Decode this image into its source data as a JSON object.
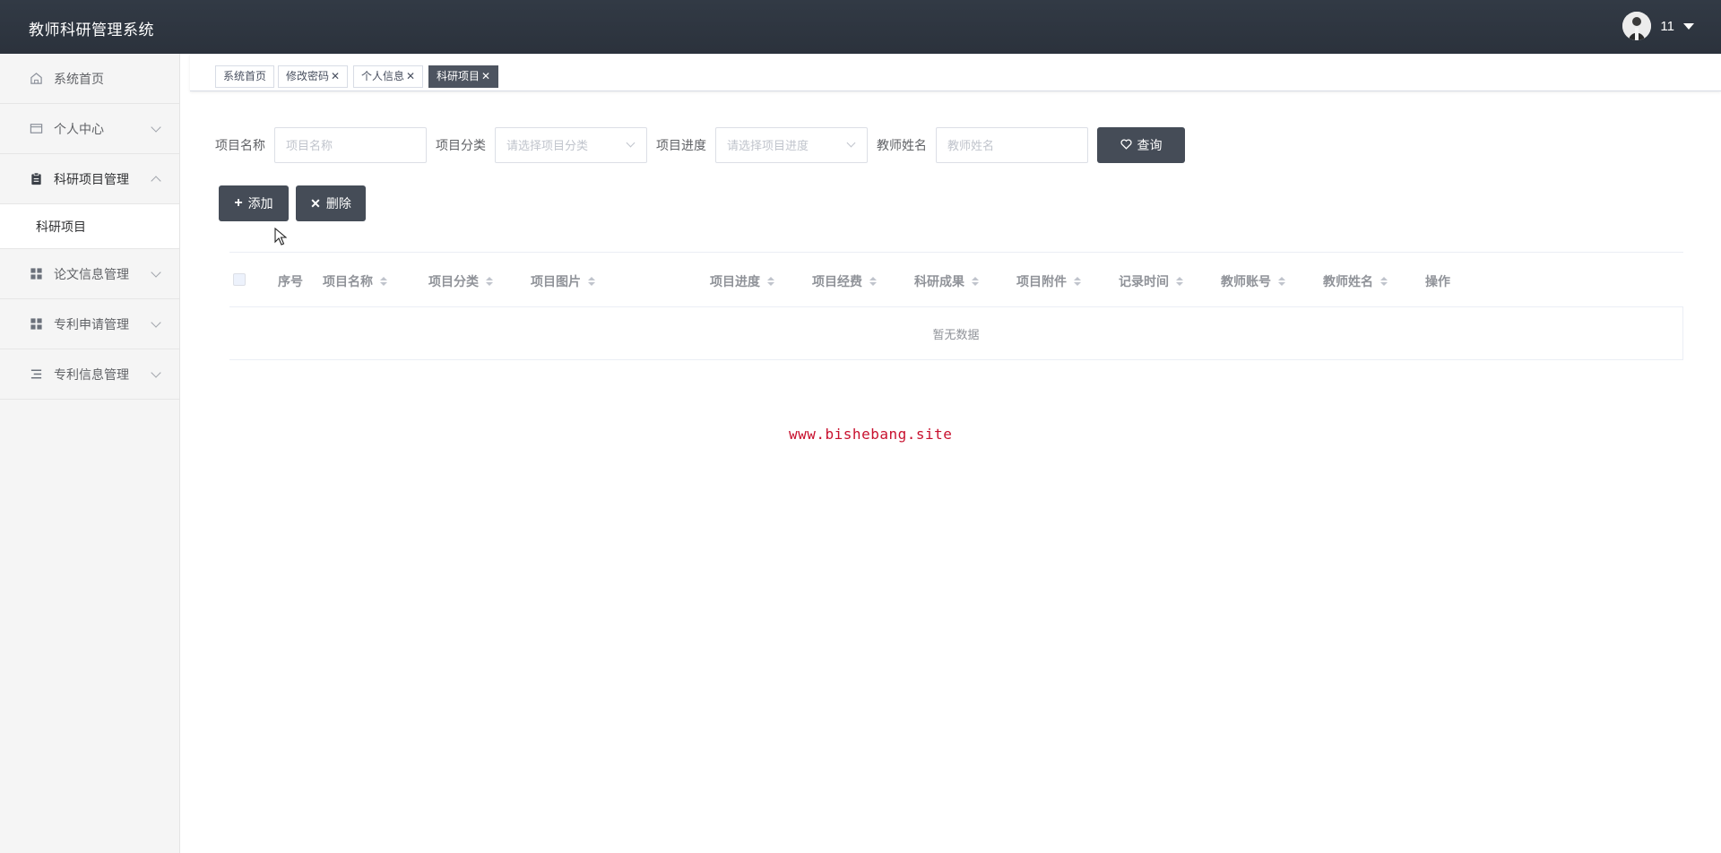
{
  "header": {
    "app_title": "教师科研管理系统",
    "user_name": "11"
  },
  "sidebar": {
    "items": [
      {
        "label": "系统首页",
        "icon": "home-icon"
      },
      {
        "label": "个人中心",
        "icon": "card-icon"
      },
      {
        "label": "科研项目管理",
        "icon": "clipboard-icon"
      },
      {
        "label": "论文信息管理",
        "icon": "grid-icon"
      },
      {
        "label": "专利申请管理",
        "icon": "grid-icon"
      },
      {
        "label": "专利信息管理",
        "icon": "list-icon"
      }
    ],
    "subitems": [
      {
        "label": "科研项目"
      }
    ]
  },
  "tabs": [
    {
      "label": "系统首页",
      "closable": false
    },
    {
      "label": "修改密码",
      "closable": true
    },
    {
      "label": "个人信息",
      "closable": true
    },
    {
      "label": "科研项目",
      "closable": true,
      "active": true
    }
  ],
  "search": {
    "project_name_label": "项目名称",
    "project_name_placeholder": "项目名称",
    "category_label": "项目分类",
    "category_placeholder": "请选择项目分类",
    "progress_label": "项目进度",
    "progress_placeholder": "请选择项目进度",
    "teacher_name_label": "教师姓名",
    "teacher_name_placeholder": "教师姓名",
    "query_button": "查询"
  },
  "actions": {
    "add_button": "添加",
    "delete_button": "删除"
  },
  "table": {
    "columns": [
      "序号",
      "项目名称",
      "项目分类",
      "项目图片",
      "项目进度",
      "项目经费",
      "科研成果",
      "项目附件",
      "记录时间",
      "教师账号",
      "教师姓名",
      "操作"
    ],
    "empty_text": "暂无数据"
  },
  "watermark": "www.bishebang.site",
  "colors": {
    "header_bg": "#2e353f",
    "button_bg": "#454c57",
    "active_tab_bg": "#4d5460",
    "watermark": "#c8102e"
  }
}
